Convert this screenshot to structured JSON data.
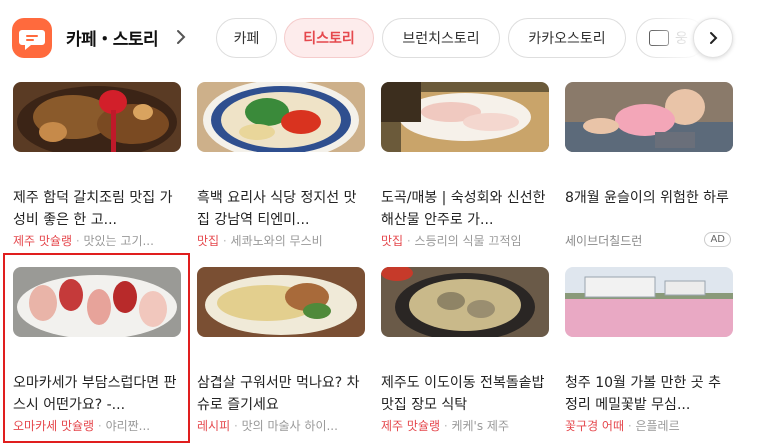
{
  "header": {
    "brand": "카페・스토리",
    "brand_chevron_icon": "chevron-right-icon",
    "chips": [
      "카페",
      "티스토리",
      "브런치스토리",
      "카카오스토리",
      "웅"
    ],
    "active_chip": "티스토리",
    "next_icon": "chevron-right-icon"
  },
  "colors": {
    "accent": "#e5484d",
    "logo": "#ff6a3d",
    "highlight": "#e01e1e"
  },
  "cards": [
    {
      "title": "제주 함덕 갈치조림 맛집 가성비 좋은 한 고...",
      "category": "제주 맛슐랭",
      "source": "맛있는 고기..."
    },
    {
      "title": "흑백 요리사 식당 정지선 맛집 강남역 티엔미...",
      "category": "맛집",
      "source": "세콰노와의 무스비"
    },
    {
      "title": "도곡/매봉 | 숙성회와 신선한 해산물 안주로 가...",
      "category": "맛집",
      "source": "스등리의 식물 끄적임"
    },
    {
      "title": "8개월 윤슬이의 위험한 하루",
      "category": "",
      "source": "세이브더칠드런",
      "ad": "AD"
    },
    {
      "title": "오마카세가 부담스럽다면 판스시 어떤가요? -...",
      "category": "오마카세 맛슐랭",
      "source": "야리짠..."
    },
    {
      "title": "삼겹살 구워서만 먹나요? 차슈로 즐기세요",
      "category": "레시피",
      "source": "맛의 마술사 하이..."
    },
    {
      "title": "제주도 이도이동 전복돌솥밥 맛집 장모 식탁",
      "category": "제주 맛슐랭",
      "source": "케케's 제주"
    },
    {
      "title": "청주 10월 가볼 만한 곳 추정리 메밀꽃밭 무심...",
      "category": "꽃구경 어때",
      "source": "은플레르"
    }
  ]
}
